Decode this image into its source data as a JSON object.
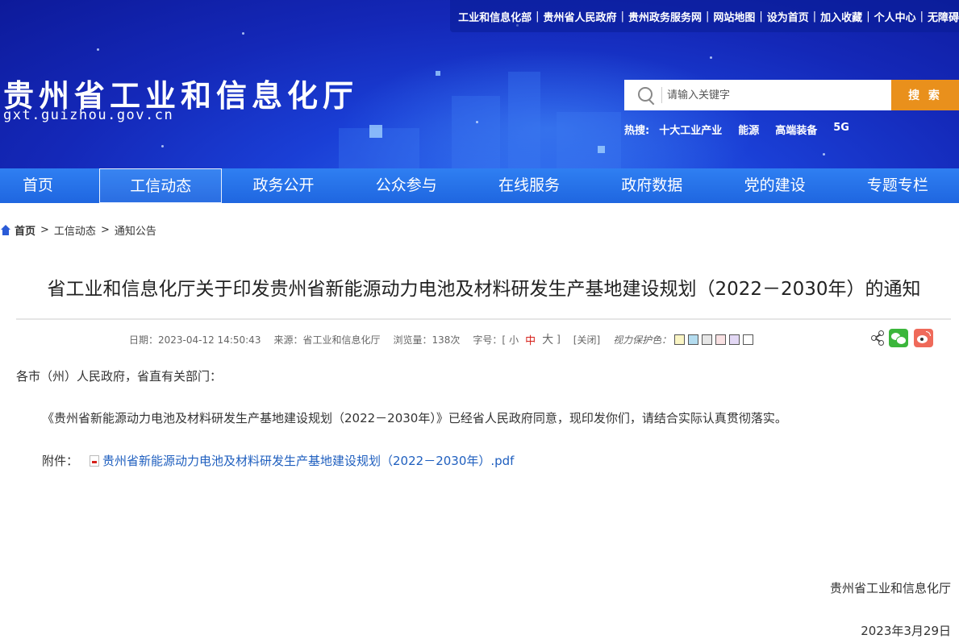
{
  "toplinks": [
    "工业和信息化部",
    "贵州省人民政府",
    "贵州政务服务网",
    "网站地图",
    "设为首页",
    "加入收藏",
    "个人中心",
    "无障碍"
  ],
  "header": {
    "title": "贵州省工业和信息化厅",
    "domain": "gxt.guizhou.gov.cn"
  },
  "search": {
    "placeholder": "请输入关键字",
    "button_label": "搜 索",
    "hot_label": "热搜:",
    "hot_terms": [
      "十大工业产业",
      "能源",
      "高端装备",
      "5G"
    ]
  },
  "nav": {
    "items": [
      "首页",
      "工信动态",
      "政务公开",
      "公众参与",
      "在线服务",
      "政府数据",
      "党的建设",
      "专题专栏"
    ],
    "active": "工信动态"
  },
  "breadcrumb": {
    "home": "首页",
    "items": [
      "工信动态",
      "通知公告"
    ],
    "separator": ">"
  },
  "article": {
    "title": "省工业和信息化厅关于印发贵州省新能源动力电池及材料研发生产基地建设规划（2022－2030年）的通知",
    "meta": {
      "date": "日期：2023-04-12 14:50:43",
      "source": "来源：省工业和信息化厅",
      "views": "浏览量：138次",
      "fontsize_label": "字号：[",
      "fontsize_small": "小",
      "fontsize_medium": "中",
      "fontsize_large": "大",
      "fontsize_end": "]",
      "close": "[关闭]",
      "eye_label": "视力保护色：",
      "eye_colors": [
        "#faf5c4",
        "#b4dcef",
        "#e6e6e6",
        "#f9e1e3",
        "#e3d8f5",
        "#ffffff"
      ]
    },
    "salutation": "各市（州）人民政府，省直有关部门：",
    "body": "《贵州省新能源动力电池及材料研发生产基地建设规划（2022－2030年）》已经省人民政府同意，现印发你们，请结合实际认真贯彻落实。",
    "attachment_label": "附件：",
    "attachment_name": "贵州省新能源动力电池及材料研发生产基地建设规划（2022－2030年）.pdf",
    "signature": "贵州省工业和信息化厅",
    "sign_date": "2023年3月29日"
  },
  "colors": {
    "nav_blue": "#2a72ea",
    "search_button": "#e9901c",
    "link_blue": "#1f5fbf",
    "accent_red": "#d6201a"
  }
}
